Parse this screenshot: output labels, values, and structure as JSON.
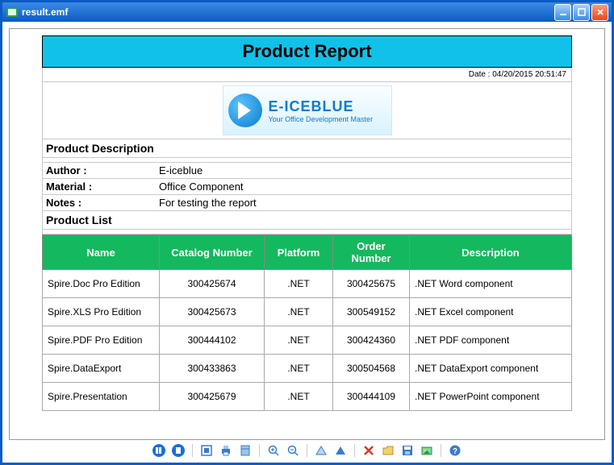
{
  "window": {
    "title": "result.emf"
  },
  "report": {
    "title": "Product Report",
    "date_label": "Date : 04/20/2015 20:51:47",
    "logo": {
      "main": "E-ICEBLUE",
      "sub": "Your Office Development Master"
    },
    "section_desc": "Product Description",
    "fields": {
      "author_label": "Author :",
      "author_value": "E-iceblue",
      "material_label": "Material :",
      "material_value": "Office Component",
      "notes_label": "Notes :",
      "notes_value": "For testing the report"
    },
    "section_list": "Product List",
    "columns": {
      "name": "Name",
      "catalog": "Catalog Number",
      "platform": "Platform",
      "order": "Order Number",
      "desc": "Description"
    },
    "rows": [
      {
        "name": "Spire.Doc Pro Edition",
        "catalog": "300425674",
        "platform": ".NET",
        "order": "300425675",
        "desc": ".NET Word component"
      },
      {
        "name": "Spire.XLS Pro Edition",
        "catalog": "300425673",
        "platform": ".NET",
        "order": "300549152",
        "desc": ".NET Excel component"
      },
      {
        "name": "Spire.PDF Pro Edition",
        "catalog": "300444102",
        "platform": ".NET",
        "order": "300424360",
        "desc": ".NET PDF component"
      },
      {
        "name": "Spire.DataExport",
        "catalog": "300433863",
        "platform": ".NET",
        "order": "300504568",
        "desc": ".NET DataExport component"
      },
      {
        "name": "Spire.Presentation",
        "catalog": "300425679",
        "platform": ".NET",
        "order": "300444109",
        "desc": ".NET PowerPoint component"
      }
    ]
  },
  "toolbar": {
    "first": "First Page",
    "next": "Next Page",
    "fit": "Fit Page",
    "print": "Print",
    "preview": "Preview",
    "zoomin": "Zoom In",
    "zoomout": "Zoom Out",
    "rotl": "Rotate Left",
    "rotr": "Rotate Right",
    "delete": "Delete",
    "open": "Open",
    "save": "Save",
    "export": "Export",
    "help": "Help"
  }
}
